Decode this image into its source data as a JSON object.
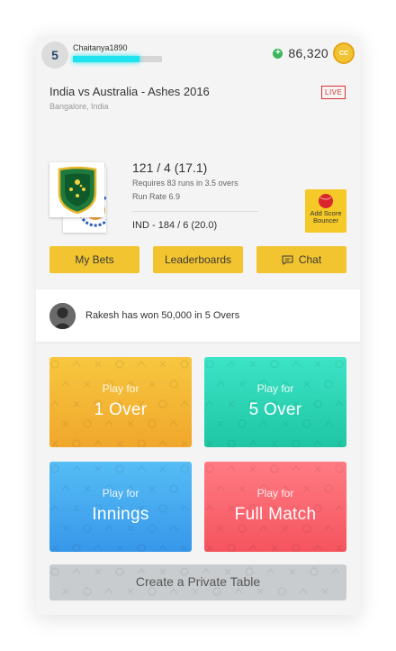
{
  "header": {
    "level": "5",
    "username": "Chaitanya1890",
    "xp_fraction": 0.75,
    "coins": "86,320",
    "coin_label": "CC"
  },
  "match": {
    "title": "India vs Australia - Ashes 2016",
    "venue": "Bangalore, India",
    "live_label": "LIVE",
    "score": "121 / 4 (17.1)",
    "requirement": "Requires 83 runs in 3.5 overs",
    "run_rate": "Run Rate 6.9",
    "opponent_score": "IND - 184 / 6 (20.0)",
    "add_score_label_1": "Add Score",
    "add_score_label_2": "Bouncer"
  },
  "actions": {
    "my_bets": "My Bets",
    "leaderboards": "Leaderboards",
    "chat": "Chat"
  },
  "winner": {
    "text": "Rakesh has won 50,000 in 5 Overs"
  },
  "tiles": [
    {
      "prefix": "Play for",
      "label": "1 Over"
    },
    {
      "prefix": "Play for",
      "label": "5 Over"
    },
    {
      "prefix": "Play for",
      "label": "Innings"
    },
    {
      "prefix": "Play for",
      "label": "Full Match"
    }
  ],
  "private_table": "Create a Private Table",
  "colors": {
    "accent_yellow": "#f2c42f",
    "xp_cyan": "#1ee3ee",
    "live_red": "#e03030",
    "tile_1_over": "#f5b935",
    "tile_5_over": "#2fd6b5",
    "tile_innings": "#45aaf0",
    "tile_full_match": "#fa6670"
  }
}
